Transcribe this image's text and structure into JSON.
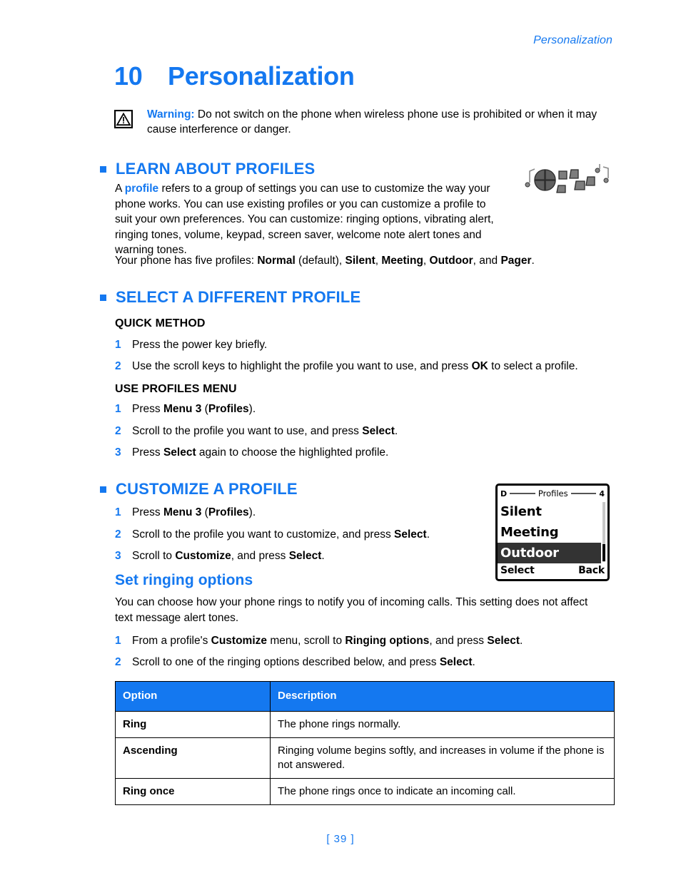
{
  "header": {
    "running_head": "Personalization",
    "chapter_number": "10",
    "chapter_title": "Personalization",
    "page_number": "[ 39 ]"
  },
  "warning": {
    "icon": "warning-triangle-icon",
    "label": "Warning:",
    "text": " Do not switch on the phone when wireless phone use is prohibited or when it may cause interference or danger."
  },
  "sections": {
    "learn": {
      "heading": "LEARN ABOUT PROFILES",
      "para1_a": "A ",
      "para1_term": "profile",
      "para1_b": " refers to a group of settings you can use to customize the way your phone works. You can use existing profiles or you can customize a profile to suit your own preferences. You can customize: ringing options, vibrating alert, ringing tones, volume, keypad, screen saver, welcome note alert tones and warning tones.",
      "para2_a": "Your phone has five profiles: ",
      "para2_p1": "Normal",
      "para2_b": " (default), ",
      "para2_p2": "Silent",
      "para2_c": ", ",
      "para2_p3": "Meeting",
      "para2_d": ", ",
      "para2_p4": "Outdoor",
      "para2_e": ", and ",
      "para2_p5": "Pager",
      "para2_f": "."
    },
    "select": {
      "heading": "SELECT A DIFFERENT PROFILE",
      "quick_method_head": "QUICK METHOD",
      "quick_steps": [
        {
          "num": "1",
          "a": "Press the power key briefly.",
          "b": "",
          "c": ""
        },
        {
          "num": "2",
          "a": "Use the scroll keys to highlight the profile you want to use, and press ",
          "b": "OK",
          "c": " to select a profile."
        }
      ],
      "use_menu_head": "USE PROFILES MENU",
      "menu_steps": [
        {
          "num": "1",
          "a": "Press ",
          "b": "Menu 3",
          "c": " (",
          "d": "Profiles",
          "e": ")."
        },
        {
          "num": "2",
          "a": "Scroll to the profile you want to use, and press ",
          "b": "Select",
          "c": "."
        },
        {
          "num": "3",
          "a": "Press ",
          "b": "Select",
          "c": " again to choose the highlighted profile."
        }
      ]
    },
    "customize": {
      "heading": "CUSTOMIZE A PROFILE",
      "steps": [
        {
          "num": "1",
          "a": "Press ",
          "b": "Menu 3",
          "c": " (",
          "d": "Profiles",
          "e": ")."
        },
        {
          "num": "2",
          "a": "Scroll to the profile you want to customize, and press ",
          "b": "Select",
          "c": "."
        },
        {
          "num": "3",
          "a": "Scroll to ",
          "b": "Customize",
          "c": ", and press ",
          "d": "Select",
          "e": "."
        }
      ]
    },
    "ringing": {
      "heading": "Set ringing options",
      "para": "You can choose how your phone rings to notify you of incoming calls. This setting does not affect text message alert tones.",
      "steps": [
        {
          "num": "1",
          "a": "From a profile's ",
          "b": "Customize",
          "c": " menu, scroll to ",
          "d": "Ringing options",
          "e": ", and press ",
          "f": "Select",
          "g": "."
        },
        {
          "num": "2",
          "a": "Scroll to one of the ringing options described below, and press ",
          "b": "Select",
          "c": "."
        }
      ]
    }
  },
  "phone_screen": {
    "status_left": "D",
    "title": "Profiles",
    "status_right": "4",
    "items": [
      {
        "label": "Silent",
        "selected": false
      },
      {
        "label": "Meeting",
        "selected": false
      },
      {
        "label": "Outdoor",
        "selected": true
      }
    ],
    "softkey_left": "Select",
    "softkey_right": "Back"
  },
  "table": {
    "columns": [
      "Option",
      "Description"
    ],
    "rows": [
      {
        "option": "Ring",
        "description": "The phone rings normally."
      },
      {
        "option": "Ascending",
        "description": "Ringing volume begins softly, and increases in volume if the phone is not answered."
      },
      {
        "option": "Ring once",
        "description": "The phone rings once to indicate an incoming call."
      }
    ]
  },
  "colors": {
    "accent_blue": "#1478F0",
    "table_header_bg": "#1478F0",
    "selected_row_bg": "#333333"
  }
}
